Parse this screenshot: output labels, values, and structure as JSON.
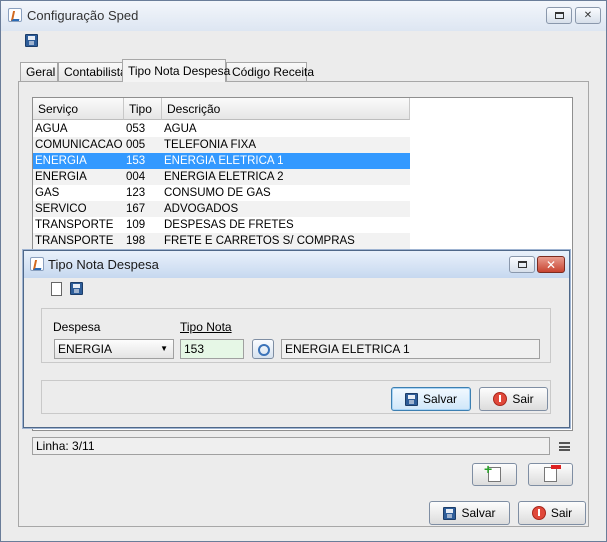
{
  "window": {
    "title": "Configuração Sped",
    "minimize_symbol": "▭",
    "close_symbol": "✕"
  },
  "tabs": [
    {
      "label": "Geral"
    },
    {
      "label": "Contabilista"
    },
    {
      "label": "Tipo Nota Despesa",
      "active": true
    },
    {
      "label": "Código Receita"
    }
  ],
  "table": {
    "columns": [
      "Serviço",
      "Tipo",
      "Descrição"
    ],
    "selected_index": 2,
    "rows": [
      {
        "servico": "AGUA",
        "tipo": "053",
        "descricao": "AGUA"
      },
      {
        "servico": "COMUNICACAO",
        "tipo": "005",
        "descricao": "TELEFONIA FIXA"
      },
      {
        "servico": "ENERGIA",
        "tipo": "153",
        "descricao": "ENERGIA ELETRICA 1"
      },
      {
        "servico": "ENERGIA",
        "tipo": "004",
        "descricao": "ENERGIA ELETRICA 2"
      },
      {
        "servico": "GAS",
        "tipo": "123",
        "descricao": "CONSUMO DE GAS"
      },
      {
        "servico": "SERVICO",
        "tipo": "167",
        "descricao": "ADVOGADOS"
      },
      {
        "servico": "TRANSPORTE",
        "tipo": "109",
        "descricao": "DESPESAS DE FRETES"
      },
      {
        "servico": "TRANSPORTE",
        "tipo": "198",
        "descricao": "FRETE E CARRETOS S/ COMPRAS"
      }
    ]
  },
  "status": {
    "linha": "Linha: 3/11"
  },
  "dialog": {
    "title": "Tipo Nota Despesa",
    "despesa_label": "Despesa",
    "tipo_nota_label": "Tipo Nota",
    "despesa_value": "ENERGIA",
    "tipo_nota_value": "153",
    "descricao_value": "ENERGIA ELETRICA 1",
    "salvar_label": "Salvar",
    "sair_label": "Sair",
    "dropdown_arrow": "▼"
  },
  "footer": {
    "salvar_label": "Salvar",
    "sair_label": "Sair"
  },
  "colors": {
    "selection": "#3399ff",
    "window_background": "#ececec",
    "tipo_nota_field": "#e6f7e6"
  }
}
